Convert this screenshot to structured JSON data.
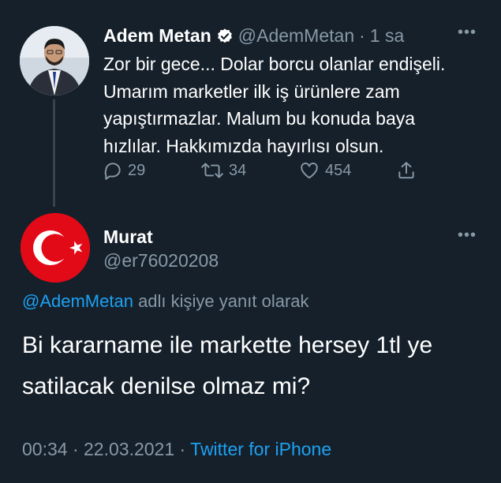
{
  "original_tweet": {
    "author_name": "Adem Metan",
    "handle": "@AdemMetan",
    "separator": "·",
    "time": "1 sa",
    "more": "•••",
    "text": "Zor bir gece... Dolar borcu olanlar endişeli. Umarım marketler ilk iş ürünlere zam yapıştırmazlar. Malum bu konuda baya hızlılar. Hakkımızda hayırlısı olsun.",
    "replies": "29",
    "retweets": "34",
    "likes": "454",
    "icons": [
      "verified-badge-icon",
      "reply-icon",
      "retweet-icon",
      "like-icon",
      "share-icon"
    ]
  },
  "reply_tweet": {
    "author_name": "Murat",
    "handle": "@er76020208",
    "more": "•••",
    "reply_to_handle": "@AdemMetan",
    "reply_to_suffix": " adlı kişiye yanıt olarak",
    "text": "Bi kararname ile markette hersey 1tl ye satilacak denilse olmaz mi?",
    "time": "00:34",
    "sep": " · ",
    "date": "22.03.2021",
    "client": "Twitter for iPhone",
    "avatar": "turkish-flag-avatar"
  },
  "colors": {
    "background": "#15202b",
    "muted": "#8899a6",
    "link": "#1da1f2",
    "flag_red": "#e30a17"
  }
}
